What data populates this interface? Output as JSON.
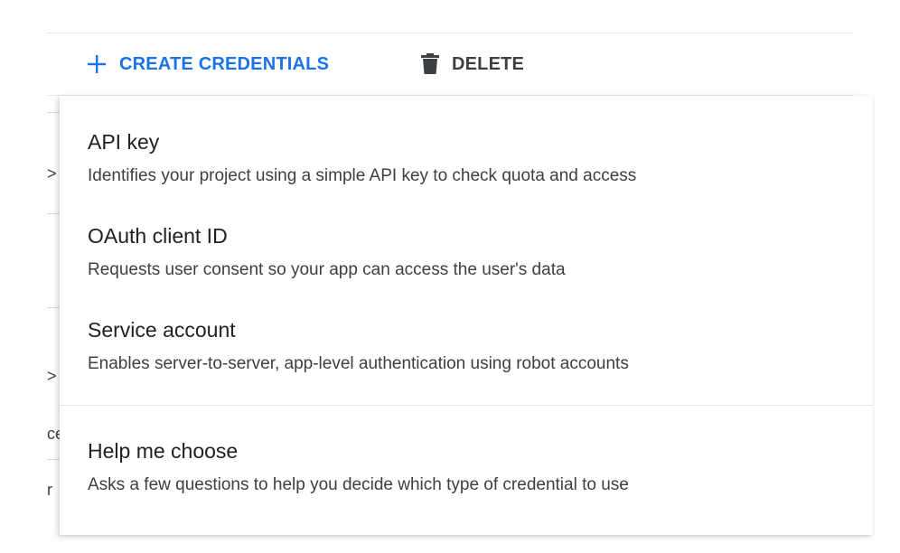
{
  "toolbar": {
    "create_label": "CREATE CREDENTIALS",
    "create_icon": "plus-icon",
    "delete_label": "DELETE",
    "delete_icon": "trash-icon"
  },
  "background_fragments": [
    ">",
    ">",
    "ce",
    "r"
  ],
  "menu": {
    "items": [
      {
        "title": "API key",
        "description": "Identifies your project using a simple API key to check quota and access"
      },
      {
        "title": "OAuth client ID",
        "description": "Requests user consent so your app can access the user's data"
      },
      {
        "title": "Service account",
        "description": "Enables server-to-server, app-level authentication using robot accounts"
      }
    ],
    "help": {
      "title": "Help me choose",
      "description": "Asks a few questions to help you decide which type of credential to use"
    }
  },
  "colors": {
    "accent": "#1a73e8",
    "text_primary": "#202124",
    "text_secondary": "#3c4043",
    "divider": "#e3e6ea"
  }
}
